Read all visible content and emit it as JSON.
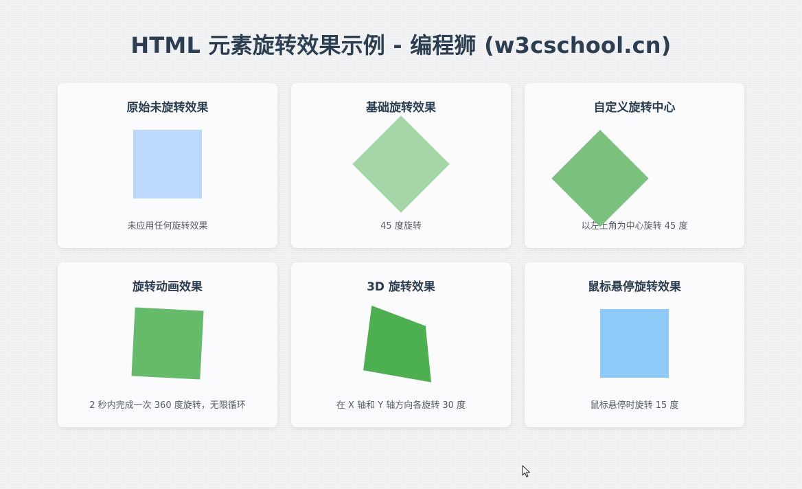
{
  "page": {
    "title": "HTML 元素旋转效果示例 - 编程狮 (w3cschool.cn)"
  },
  "cards": [
    {
      "title": "原始未旋转效果",
      "desc": "未应用任何旋转效果",
      "color": "#bcd9fb"
    },
    {
      "title": "基础旋转效果",
      "desc": "45 度旋转",
      "color": "#a5d6a7"
    },
    {
      "title": "自定义旋转中心",
      "desc": "以左上角为中心旋转 45 度",
      "color": "#79c17c"
    },
    {
      "title": "旋转动画效果",
      "desc": "2 秒内完成一次 360 度旋转，无限循环",
      "color": "#66bb6a"
    },
    {
      "title": "3D 旋转效果",
      "desc": "在 X 轴和 Y 轴方向各旋转 30 度",
      "color": "#4caf50"
    },
    {
      "title": "鼠标悬停旋转效果",
      "desc": "鼠标悬停时旋转 15 度",
      "color": "#90caf9"
    }
  ],
  "icons": {
    "cursor": "mouse-pointer-icon"
  }
}
